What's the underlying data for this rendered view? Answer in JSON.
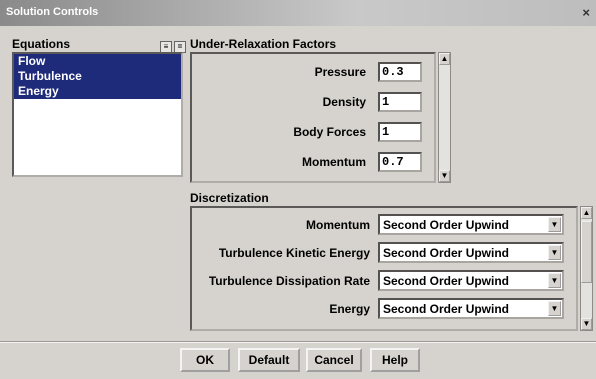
{
  "window": {
    "title": "Solution Controls",
    "close_glyph": "×"
  },
  "equations": {
    "label": "Equations",
    "items": [
      "Flow",
      "Turbulence",
      "Energy"
    ]
  },
  "under_relaxation": {
    "label": "Under-Relaxation Factors",
    "rows": [
      {
        "label": "Pressure",
        "value": "0.3"
      },
      {
        "label": "Density",
        "value": "1"
      },
      {
        "label": "Body Forces",
        "value": "1"
      },
      {
        "label": "Momentum",
        "value": "0.7"
      }
    ]
  },
  "discretization": {
    "label": "Discretization",
    "rows": [
      {
        "label": "Momentum",
        "value": "Second Order Upwind"
      },
      {
        "label": "Turbulence Kinetic Energy",
        "value": "Second Order Upwind"
      },
      {
        "label": "Turbulence Dissipation Rate",
        "value": "Second Order Upwind"
      },
      {
        "label": "Energy",
        "value": "Second Order Upwind"
      }
    ]
  },
  "buttons": {
    "ok": "OK",
    "default": "Default",
    "cancel": "Cancel",
    "help": "Help"
  },
  "colors": {
    "selection": "#1e2a7a",
    "panel": "#d6d3ce"
  }
}
